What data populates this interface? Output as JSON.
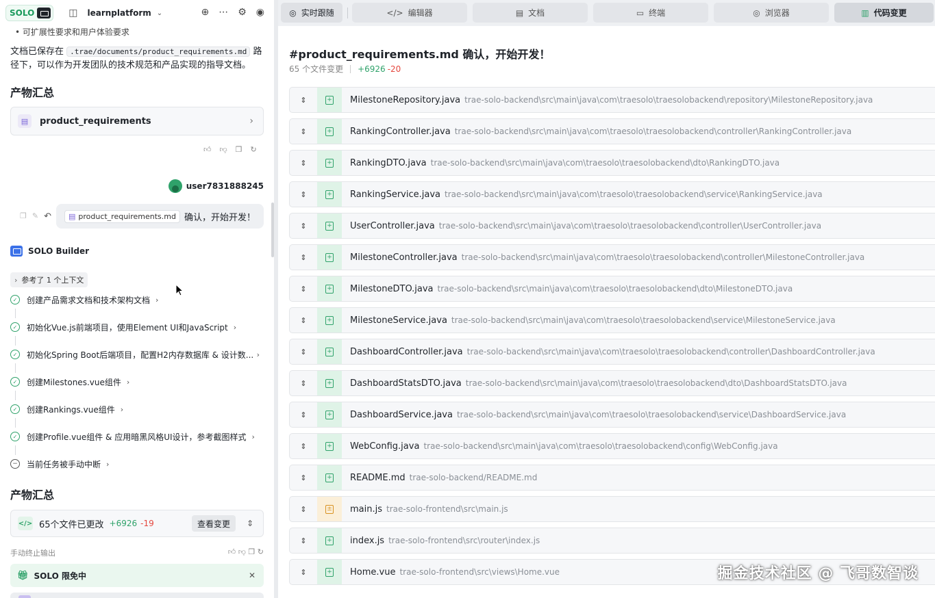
{
  "topbar": {
    "solo_badge": "SOLO",
    "workspace": "learnplatform",
    "icons": [
      "sidebar-icon",
      "chevron-down-icon",
      "add-chat-icon",
      "more-icon",
      "gear-icon",
      "account-icon"
    ]
  },
  "left": {
    "bullet_text": "• 可扩展性要求和用户体验要求",
    "doc_para_prefix": "文档已保存在 ",
    "doc_path": ".trae/documents/product_requirements.md",
    "doc_para_suffix": " 路径下，可以作为开发团队的技术规范和产品实现的指导文档。",
    "section1_title": "产物汇总",
    "artifact_name": "product_requirements",
    "user_name": "user7831888245",
    "message_tag": "product_requirements.md",
    "message_text": "确认，开始开发！",
    "builder_name": "SOLO Builder",
    "ref_text": "参考了 1 个上下文",
    "tasks": [
      {
        "label": "创建产品需求文档和技术架构文档",
        "status": "done"
      },
      {
        "label": "初始化Vue.js前端项目，使用Element UI和JavaScript",
        "status": "done"
      },
      {
        "label": "初始化Spring Boot后端项目，配置H2内存数据库 & 设计数...",
        "status": "done"
      },
      {
        "label": "创建Milestones.vue组件",
        "status": "done"
      },
      {
        "label": "创建Rankings.vue组件",
        "status": "done"
      },
      {
        "label": "创建Profile.vue组件 & 应用暗黑风格UI设计，参考截图样式",
        "status": "done"
      },
      {
        "label": "当前任务被手动中断",
        "status": "stopped"
      }
    ],
    "section2_title": "产物汇总",
    "changes_label": "65个文件已更改",
    "changes_plus": "+6926",
    "changes_minus": "-19",
    "view_changes_btn": "查看变更",
    "cut_text": "手动终止输出",
    "promo_text": "SOLO 限免中"
  },
  "tabs": [
    {
      "label": "实时跟随",
      "icon": "live-icon"
    },
    {
      "label": "编辑器",
      "icon": "code-icon"
    },
    {
      "label": "文档",
      "icon": "document-icon"
    },
    {
      "label": "终端",
      "icon": "terminal-icon"
    },
    {
      "label": "浏览器",
      "icon": "compass-icon"
    },
    {
      "label": "代码变更",
      "icon": "diff-icon"
    }
  ],
  "right": {
    "title": "#product_requirements.md 确认，开始开发！",
    "files_changed": "65 个文件变更",
    "plus": "+6926",
    "minus": "-20",
    "files": [
      {
        "name": "MilestoneRepository.java",
        "path": "trae-solo-backend\\src\\main\\java\\com\\traesolo\\traesolobackend\\repository\\MilestoneRepository.java",
        "status": "added"
      },
      {
        "name": "RankingController.java",
        "path": "trae-solo-backend\\src\\main\\java\\com\\traesolo\\traesolobackend\\controller\\RankingController.java",
        "status": "added"
      },
      {
        "name": "RankingDTO.java",
        "path": "trae-solo-backend\\src\\main\\java\\com\\traesolo\\traesolobackend\\dto\\RankingDTO.java",
        "status": "added"
      },
      {
        "name": "RankingService.java",
        "path": "trae-solo-backend\\src\\main\\java\\com\\traesolo\\traesolobackend\\service\\RankingService.java",
        "status": "added"
      },
      {
        "name": "UserController.java",
        "path": "trae-solo-backend\\src\\main\\java\\com\\traesolo\\traesolobackend\\controller\\UserController.java",
        "status": "added"
      },
      {
        "name": "MilestoneController.java",
        "path": "trae-solo-backend\\src\\main\\java\\com\\traesolo\\traesolobackend\\controller\\MilestoneController.java",
        "status": "added"
      },
      {
        "name": "MilestoneDTO.java",
        "path": "trae-solo-backend\\src\\main\\java\\com\\traesolo\\traesolobackend\\dto\\MilestoneDTO.java",
        "status": "added"
      },
      {
        "name": "MilestoneService.java",
        "path": "trae-solo-backend\\src\\main\\java\\com\\traesolo\\traesolobackend\\service\\MilestoneService.java",
        "status": "added"
      },
      {
        "name": "DashboardController.java",
        "path": "trae-solo-backend\\src\\main\\java\\com\\traesolo\\traesolobackend\\controller\\DashboardController.java",
        "status": "added"
      },
      {
        "name": "DashboardStatsDTO.java",
        "path": "trae-solo-backend\\src\\main\\java\\com\\traesolo\\traesolobackend\\dto\\DashboardStatsDTO.java",
        "status": "added"
      },
      {
        "name": "DashboardService.java",
        "path": "trae-solo-backend\\src\\main\\java\\com\\traesolo\\traesolobackend\\service\\DashboardService.java",
        "status": "added"
      },
      {
        "name": "WebConfig.java",
        "path": "trae-solo-backend\\src\\main\\java\\com\\traesolo\\traesolobackend\\config\\WebConfig.java",
        "status": "added"
      },
      {
        "name": "README.md",
        "path": "trae-solo-backend/README.md",
        "status": "added"
      },
      {
        "name": "main.js",
        "path": "trae-solo-frontend\\src\\main.js",
        "status": "modified"
      },
      {
        "name": "index.js",
        "path": "trae-solo-frontend\\src\\router\\index.js",
        "status": "added"
      },
      {
        "name": "Home.vue",
        "path": "trae-solo-frontend\\src\\views\\Home.vue",
        "status": "added"
      }
    ]
  },
  "watermark": "掘金技术社区 @ 飞哥数智谈",
  "colors": {
    "accent_green": "#2fa26a",
    "minus_red": "#e5483f",
    "modified_orange": "#d99222"
  }
}
